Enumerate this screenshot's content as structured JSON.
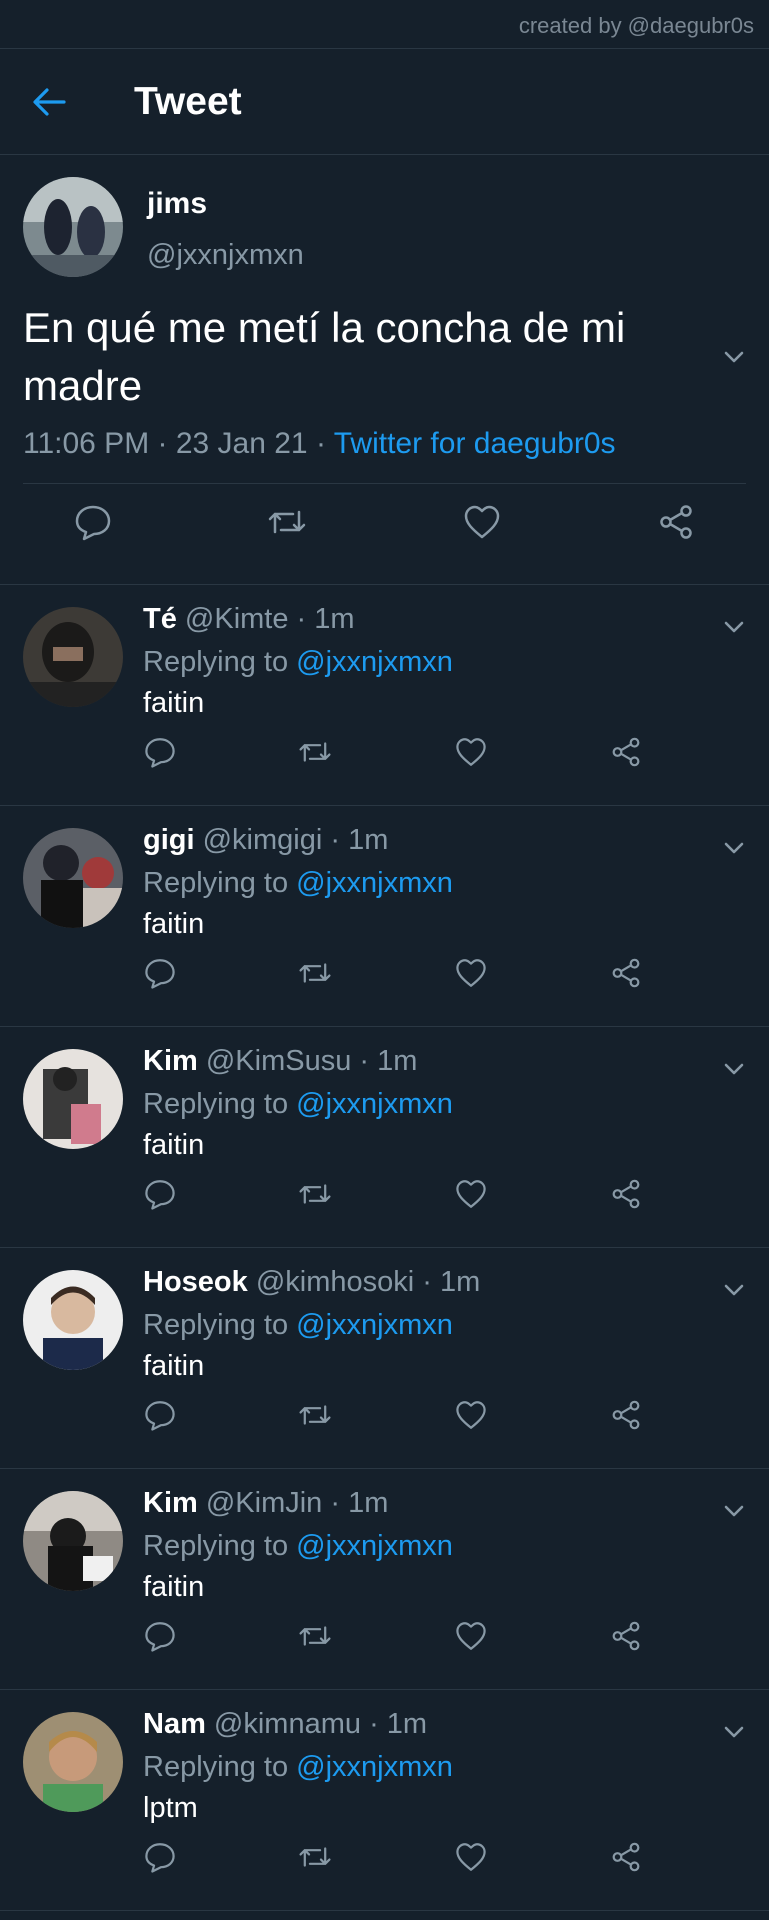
{
  "credit": "created by @daegubr0s",
  "header": {
    "title": "Tweet"
  },
  "main_tweet": {
    "name": "jims",
    "handle": "@jxxnjxmxn",
    "text": "En qué me metí la concha de mi madre",
    "time": "11:06 PM · 23 Jan 21 · ",
    "source": "Twitter for daegubr0s"
  },
  "replies": [
    {
      "name": "Té",
      "handle": "@Kimte",
      "time": " · 1m",
      "replying": "Replying to ",
      "mention": "@jxxnjxmxn",
      "text": "faitin"
    },
    {
      "name": "gigi",
      "handle": "@kimgigi",
      "time": " · 1m",
      "replying": "Replying to ",
      "mention": "@jxxnjxmxn",
      "text": "faitin"
    },
    {
      "name": "Kim",
      "handle": "@KimSusu",
      "time": " · 1m",
      "replying": "Replying to ",
      "mention": "@jxxnjxmxn",
      "text": "faitin"
    },
    {
      "name": "Hoseok",
      "handle": "@kimhosoki",
      "time": " · 1m",
      "replying": "Replying to ",
      "mention": "@jxxnjxmxn",
      "text": "faitin"
    },
    {
      "name": "Kim",
      "handle": "@KimJin",
      "time": " · 1m",
      "replying": "Replying to ",
      "mention": "@jxxnjxmxn",
      "text": "faitin"
    },
    {
      "name": "Nam",
      "handle": "@kimnamu",
      "time": " · 1m",
      "replying": "Replying to ",
      "mention": "@jxxnjxmxn",
      "text": "lptm"
    }
  ],
  "icons": {
    "back": "back-arrow-icon",
    "more": "chevron-down-icon",
    "actions": [
      "reply-icon",
      "retweet-icon",
      "like-icon",
      "share-icon"
    ]
  },
  "colors": {
    "background": "#15202b",
    "accent": "#1d9bf0",
    "muted": "#8899a6",
    "divider": "#2a3743"
  }
}
